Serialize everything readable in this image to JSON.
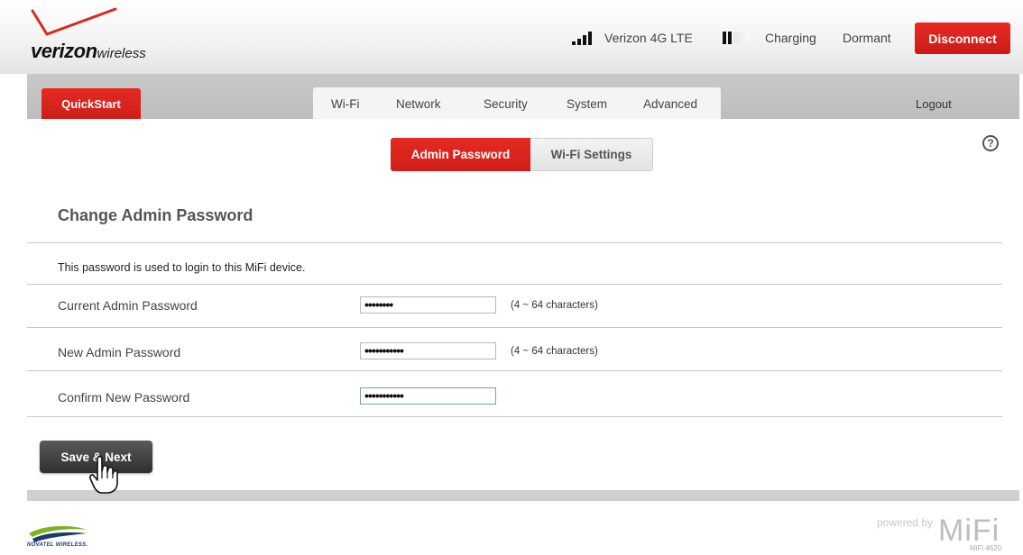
{
  "header": {
    "logo": {
      "brand": "verizon",
      "suffix": "wireless"
    },
    "status": {
      "carrier": "Verizon 4G LTE",
      "battery_status": "Charging",
      "connection_status": "Dormant"
    },
    "disconnect_label": "Disconnect"
  },
  "nav": {
    "quickstart_label": "QuickStart",
    "tabs": [
      {
        "label": "Wi-Fi"
      },
      {
        "label": "Network"
      },
      {
        "label": "Security"
      },
      {
        "label": "System"
      },
      {
        "label": "Advanced"
      }
    ],
    "logout_label": "Logout"
  },
  "subtabs": {
    "admin_password": "Admin Password",
    "wifi_settings": "Wi-Fi Settings",
    "active": "Admin Password"
  },
  "form": {
    "title": "Change Admin Password",
    "description": "This password is used to login to this MiFi device.",
    "fields": [
      {
        "label": "Current Admin Password",
        "value": "••••••••",
        "hint": "(4 ~ 64 characters)"
      },
      {
        "label": "New Admin Password",
        "value": "•••••••••••",
        "hint": "(4 ~ 64 characters)"
      },
      {
        "label": "Confirm New Password",
        "value": "•••••••••••",
        "hint": ""
      }
    ],
    "save_label": "Save & Next"
  },
  "footer": {
    "novatel": "NOVATEL WIRELESS.",
    "powered_by": "powered by",
    "mifi": "MiFi",
    "model": "MiFi 4620"
  },
  "colors": {
    "brand_red": "#d52b1e",
    "nav_gray": "#c4c4c4",
    "dark_button": "#3a3a3a"
  },
  "icons": {
    "help": "help-icon",
    "signal": "signal-bars-icon",
    "battery": "battery-icon",
    "cursor": "hand-pointer-icon"
  }
}
